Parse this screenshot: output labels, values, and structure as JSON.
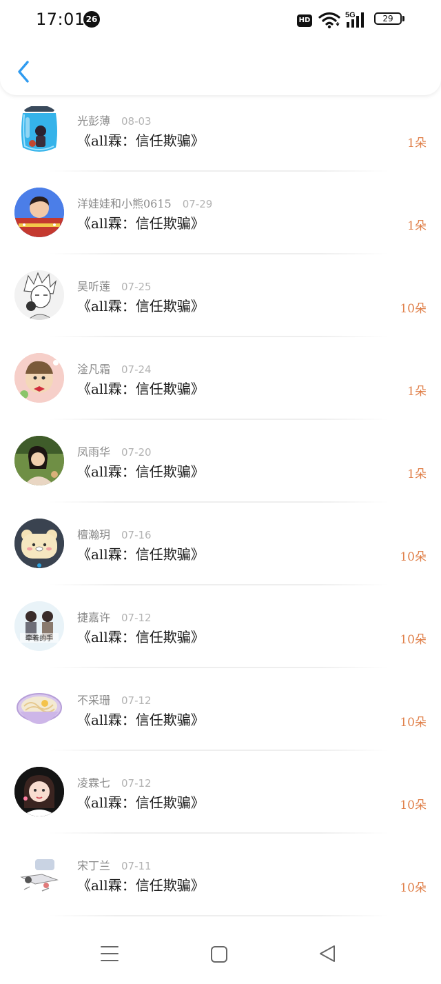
{
  "status_bar": {
    "time": "17:01",
    "notification_count": "26",
    "hd_label": "HD",
    "network_label": "5G",
    "battery_level": "29"
  },
  "header": {
    "back_icon": "chevron-left-icon",
    "accent_color": "#2f9bf0"
  },
  "list": {
    "count_color": "#e0804a",
    "items": [
      {
        "name": "光彭薄",
        "date": "08-03",
        "title": "《all霖：信任欺骗》",
        "count": "1朵",
        "avatar": "glass-jar-figure"
      },
      {
        "name": "洋娃娃和小熊0615",
        "date": "07-29",
        "title": "《all霖：信任欺骗》",
        "count": "1朵",
        "avatar": "young-man-portrait"
      },
      {
        "name": "吴听莲",
        "date": "07-25",
        "title": "《all霖：信任欺骗》",
        "count": "10朵",
        "avatar": "anime-sketch-boy"
      },
      {
        "name": "淦凡霜",
        "date": "07-24",
        "title": "《all霖：信任欺骗》",
        "count": "1朵",
        "avatar": "baby-with-bow"
      },
      {
        "name": "凤雨华",
        "date": "07-20",
        "title": "《all霖：信任欺骗》",
        "count": "1朵",
        "avatar": "girl-outdoors"
      },
      {
        "name": "檀瀚玥",
        "date": "07-16",
        "title": "《all霖：信任欺骗》",
        "count": "10朵",
        "avatar": "bear-cartoon"
      },
      {
        "name": "捷嘉许",
        "date": "07-12",
        "title": "《all霖：信任欺骗》",
        "count": "10朵",
        "avatar": "couple-photo"
      },
      {
        "name": "不采珊",
        "date": "07-12",
        "title": "《all霖：信任欺骗》",
        "count": "10朵",
        "avatar": "noodle-bowl"
      },
      {
        "name": "凌霖七",
        "date": "07-12",
        "title": "《all霖：信任欺骗》",
        "count": "10朵",
        "avatar": "girl-portrait"
      },
      {
        "name": "宋丁兰",
        "date": "07-11",
        "title": "《all霖：信任欺骗》",
        "count": "10朵",
        "avatar": "sketch-scene"
      }
    ]
  },
  "avatar_caption": "牵着的手",
  "nav_bar": {
    "menu_icon": "menu-icon",
    "home_icon": "square-home-icon",
    "back_icon": "triangle-back-icon"
  }
}
